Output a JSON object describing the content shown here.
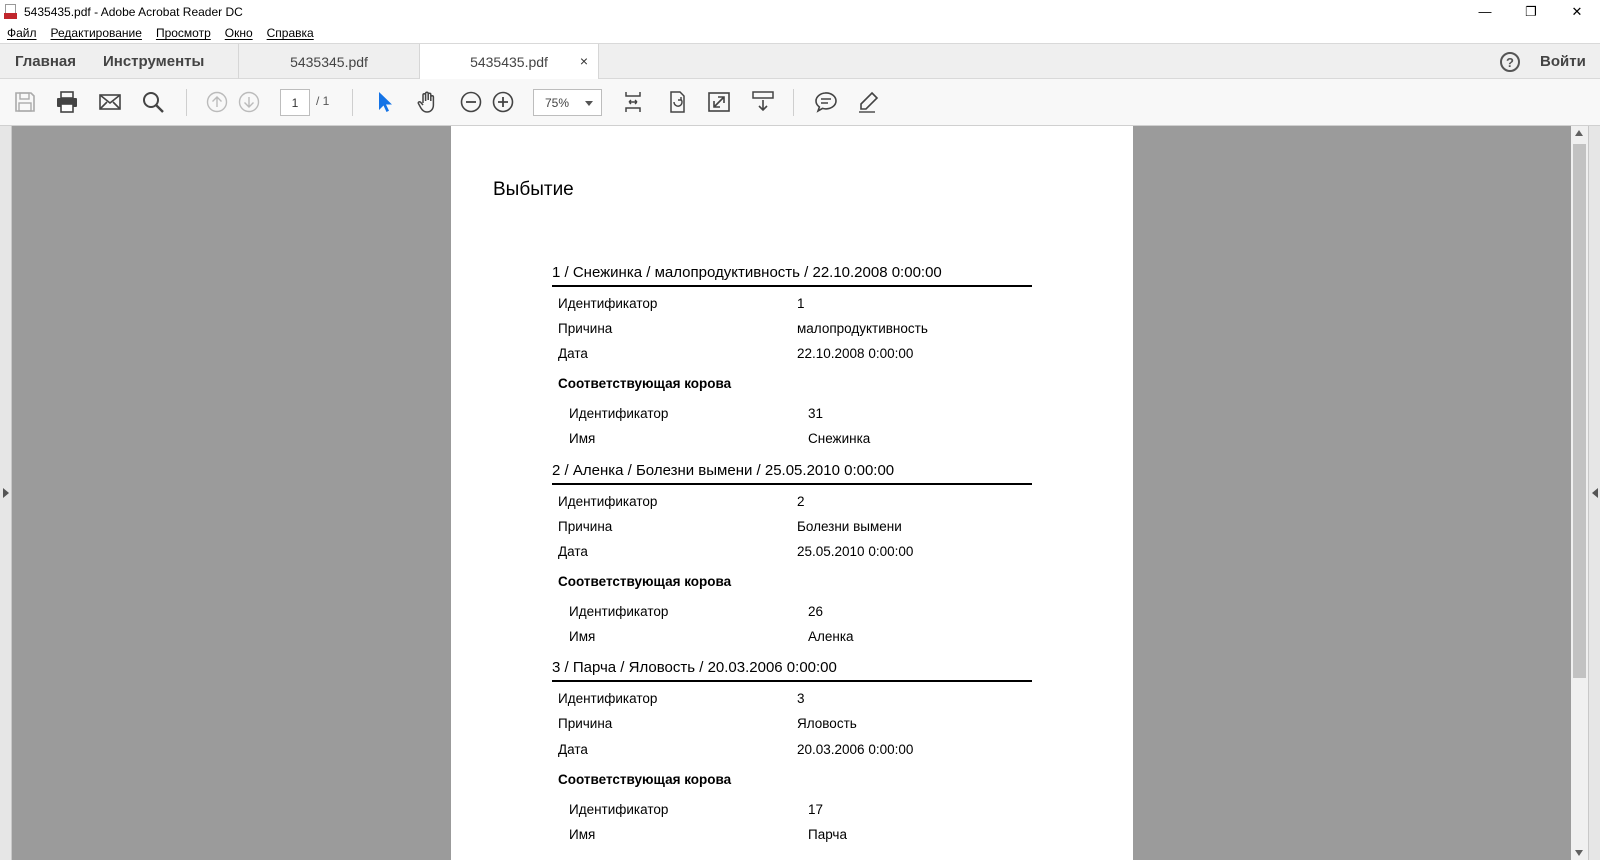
{
  "window": {
    "title": "5435435.pdf - Adobe Acrobat Reader DC",
    "minimize_glyph": "—",
    "maximize_glyph": "❐",
    "close_glyph": "✕"
  },
  "menu": [
    "Файл",
    "Редактирование",
    "Просмотр",
    "Окно",
    "Справка"
  ],
  "tabs": {
    "home": "Главная",
    "tools": "Инструменты",
    "docs": [
      {
        "label": "5435345.pdf"
      },
      {
        "label": "5435435.pdf"
      }
    ],
    "close_glyph": "×",
    "help_glyph": "?",
    "signin": "Войти"
  },
  "toolbar": {
    "page_current": "1",
    "page_total": "/ 1",
    "zoom": "75%"
  },
  "document": {
    "title": "Выбытие",
    "labels": {
      "id": "Идентификатор",
      "reason": "Причина",
      "date": "Дата",
      "cow": "Соответствующая корова",
      "name": "Имя"
    },
    "records": [
      {
        "heading": "1 / Снежинка / малопродуктивность / 22.10.2008 0:00:00",
        "id": "1",
        "reason": "малопродуктивность",
        "date": "22.10.2008 0:00:00",
        "cow_id": "31",
        "cow_name": "Снежинка"
      },
      {
        "heading": "2 / Аленка / Болезни вымени / 25.05.2010 0:00:00",
        "id": "2",
        "reason": "Болезни вымени",
        "date": "25.05.2010 0:00:00",
        "cow_id": "26",
        "cow_name": "Аленка"
      },
      {
        "heading": "3 / Парча / Яловость / 20.03.2006 0:00:00",
        "id": "3",
        "reason": "Яловость",
        "date": "20.03.2006 0:00:00",
        "cow_id": "17",
        "cow_name": "Парча"
      }
    ]
  }
}
